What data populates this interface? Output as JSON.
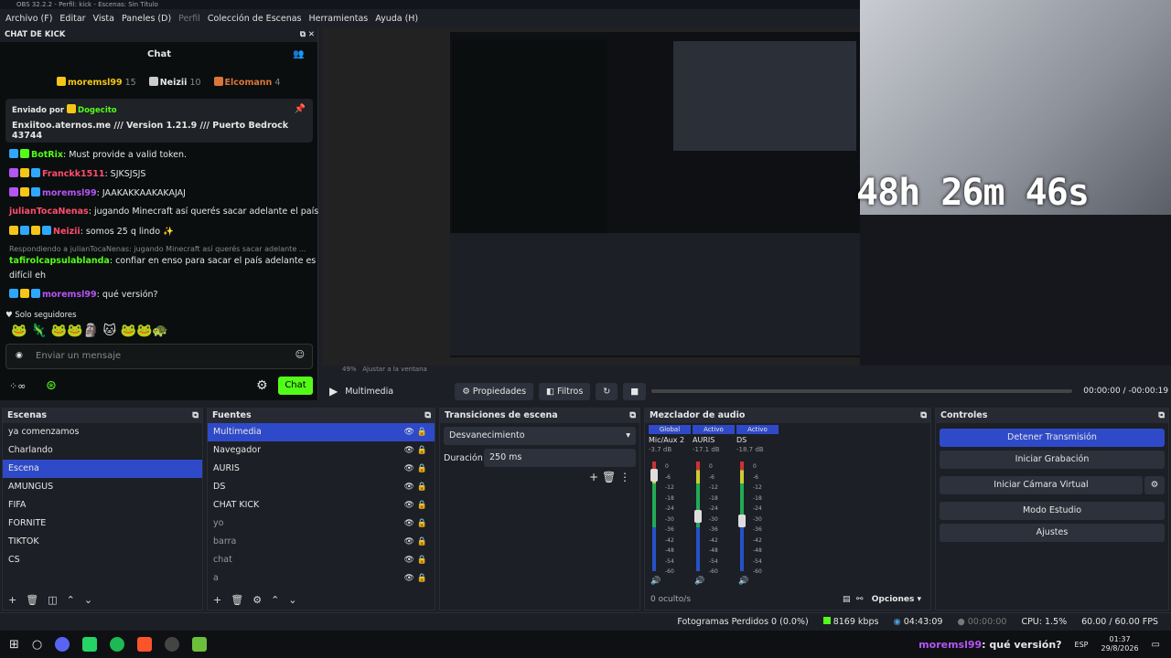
{
  "window": {
    "title": "OBS 32.2.2 - Perfil: kick - Escenas: Sin Título"
  },
  "menu": [
    {
      "label": "Archivo (F)"
    },
    {
      "label": "Editar"
    },
    {
      "label": "Vista"
    },
    {
      "label": "Paneles (D)"
    },
    {
      "label": "Perfil"
    },
    {
      "label": "Colección de Escenas"
    },
    {
      "label": "Herramientas"
    },
    {
      "label": "Ayuda (H)"
    }
  ],
  "chat": {
    "dock_title": "CHAT DE KICK",
    "title": "Chat",
    "leaders": [
      {
        "name": "moremsl99",
        "count": "15"
      },
      {
        "name": "Neizii",
        "count": "10"
      },
      {
        "name": "Elcomann",
        "count": "4"
      }
    ],
    "pinned": {
      "by_label": "Enviado por",
      "by_user": "Dogecito",
      "text": "Enxiitoo.aternos.me /// Version 1.21.9 /// Puerto Bedrock 43744"
    },
    "messages": [
      {
        "user": "BotRix",
        "text": ": Must provide a valid token.",
        "color": "#53fc18"
      },
      {
        "user": "Franckk1511",
        "text": ": SJKSJSJS",
        "color": "#ff4d6d"
      },
      {
        "user": "moremsl99",
        "text": ": JAAKAKKAAKAKAJAJ",
        "color": "#b455f5"
      },
      {
        "user": "julianTocaNenas",
        "text": ": jugando Minecraft así querés sacar adelante el país",
        "color": "#ff4d6d"
      },
      {
        "user": "Neizii",
        "text": ": somos 25 q lindo ✨",
        "color": "#ff4d6d"
      },
      {
        "reply": "Respondiendo a julianTocaNenas: jugando Minecraft así querés sacar adelante ..."
      },
      {
        "user": "tafirolcapsulablanda",
        "text": ": confiar en enso para sacar el país adelante es",
        "text2": "difícil eh",
        "color": "#53fc18"
      },
      {
        "user": "moremsl99",
        "text": ": qué versión?",
        "color": "#b455f5"
      }
    ],
    "followers": "Solo seguidores",
    "input_placeholder": "Enviar un mensaje",
    "send_label": "Chat"
  },
  "overlay": {
    "timer": "48h 26m 46s"
  },
  "preview": {
    "zoom": "49%",
    "fit_label": "Ajustar a la ventana"
  },
  "media": {
    "source": "Multimedia",
    "props": "Propiedades",
    "filters": "Filtros",
    "time_current": "00:00:00",
    "time_sep": "/",
    "time_total": "-00:00:19"
  },
  "scenes": {
    "title": "Escenas",
    "items": [
      "ya comenzamos",
      "Charlando",
      "Escena",
      "AMUNGUS",
      "FIFA",
      "FORNITE",
      "TIKTOK",
      "CS"
    ],
    "selected": 2
  },
  "sources": {
    "title": "Fuentes",
    "items": [
      "Multimedia",
      "Navegador",
      "AURIS",
      "DS",
      "CHAT KICK",
      "yo",
      "barra",
      "chat",
      "a"
    ]
  },
  "transitions": {
    "title": "Transiciones de escena",
    "type": "Desvanecimiento",
    "duration_label": "Duración",
    "duration": "250 ms"
  },
  "mixer": {
    "title": "Mezclador de audio",
    "channels": [
      {
        "name": "Mic/Aux 2",
        "db": "-3.7 dB",
        "tag": "Global",
        "level": 0.93
      },
      {
        "name": "AURIS",
        "db": "-17.1 dB",
        "tag": "Activo",
        "level": 0.56
      },
      {
        "name": "DS",
        "db": "-18.7 dB",
        "tag": "Activo",
        "level": 0.52
      }
    ],
    "hidden": "0 oculto/s",
    "options": "Opciones",
    "scale": [
      "0",
      "-6",
      "-12",
      "-18",
      "-24",
      "-30",
      "-36",
      "-42",
      "-48",
      "-54",
      "-60"
    ]
  },
  "controls": {
    "title": "Controles",
    "buttons": [
      "Detener Transmisión",
      "Iniciar Grabación",
      "Iniciar Cámara Virtual",
      "Modo Estudio",
      "Ajustes"
    ]
  },
  "status": {
    "dropped": "Fotogramas Perdidos 0 (0.0%)",
    "kbps": "8169 kbps",
    "live": "04:43:09",
    "rec": "00:00:00",
    "cpu": "CPU: 1.5%",
    "fps": "60.00 / 60.00 FPS"
  },
  "taskbar": {
    "notif_user": "moremsl99",
    "notif_text": ": qué versión?",
    "lang": "ESP",
    "time": "01:37",
    "date": "29/8/2026"
  },
  "colors": {
    "accent": "#2f4ac8",
    "kick": "#53fc18"
  }
}
